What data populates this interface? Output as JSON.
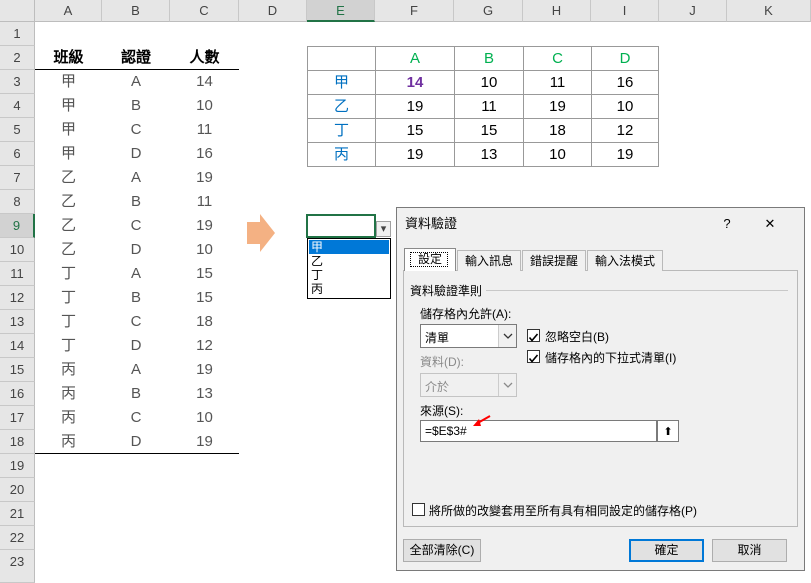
{
  "columns": [
    "A",
    "B",
    "C",
    "D",
    "E",
    "F",
    "G",
    "H",
    "I",
    "J",
    "K"
  ],
  "rows": [
    "1",
    "2",
    "3",
    "4",
    "5",
    "6",
    "7",
    "8",
    "9",
    "10",
    "11",
    "12",
    "13",
    "14",
    "15",
    "16",
    "17",
    "18",
    "19",
    "20",
    "21",
    "22",
    "23"
  ],
  "left_table": {
    "headers": [
      "班級",
      "認證",
      "人數"
    ],
    "data": [
      [
        "甲",
        "A",
        "14"
      ],
      [
        "甲",
        "B",
        "10"
      ],
      [
        "甲",
        "C",
        "11"
      ],
      [
        "甲",
        "D",
        "16"
      ],
      [
        "乙",
        "A",
        "19"
      ],
      [
        "乙",
        "B",
        "11"
      ],
      [
        "乙",
        "C",
        "19"
      ],
      [
        "乙",
        "D",
        "10"
      ],
      [
        "丁",
        "A",
        "15"
      ],
      [
        "丁",
        "B",
        "15"
      ],
      [
        "丁",
        "C",
        "18"
      ],
      [
        "丁",
        "D",
        "12"
      ],
      [
        "丙",
        "A",
        "19"
      ],
      [
        "丙",
        "B",
        "13"
      ],
      [
        "丙",
        "C",
        "10"
      ],
      [
        "丙",
        "D",
        "19"
      ]
    ]
  },
  "matrix": {
    "col_headers": [
      "A",
      "B",
      "C",
      "D"
    ],
    "rows": [
      {
        "label": "甲",
        "values": [
          "14",
          "10",
          "11",
          "16"
        ]
      },
      {
        "label": "乙",
        "values": [
          "19",
          "11",
          "19",
          "10"
        ]
      },
      {
        "label": "丁",
        "values": [
          "15",
          "15",
          "18",
          "12"
        ]
      },
      {
        "label": "丙",
        "values": [
          "19",
          "13",
          "10",
          "19"
        ]
      }
    ]
  },
  "dropdown": {
    "items": [
      "甲",
      "乙",
      "丁",
      "丙"
    ],
    "selected_index": 0,
    "arrow": "▾"
  },
  "colors": {
    "green": "#00b050",
    "blue": "#0070c0",
    "purple": "#7030a0",
    "arrow_orange": "#f4b183",
    "accent": "#217346"
  },
  "dialog": {
    "title": "資料驗證",
    "help": "?",
    "close": "✕",
    "tabs": [
      "設定",
      "輸入訊息",
      "錯誤提醒",
      "輸入法模式"
    ],
    "active_tab": 0,
    "group_label": "資料驗證準則",
    "allow_label": "儲存格內允許(A):",
    "allow_value": "清單",
    "ignore_blank_label": "忽略空白(B)",
    "ignore_blank_checked": true,
    "in_cell_dropdown_label": "儲存格內的下拉式清單(I)",
    "in_cell_dropdown_checked": true,
    "data_label": "資料(D):",
    "data_value": "介於",
    "source_label": "來源(S):",
    "source_value": "=$E$3#",
    "collapse_icon": "⬆",
    "apply_all_label": "將所做的改變套用至所有具有相同設定的儲存格(P)",
    "apply_all_checked": false,
    "clear_all_label": "全部清除(C)",
    "ok_label": "確定",
    "cancel_label": "取消"
  }
}
